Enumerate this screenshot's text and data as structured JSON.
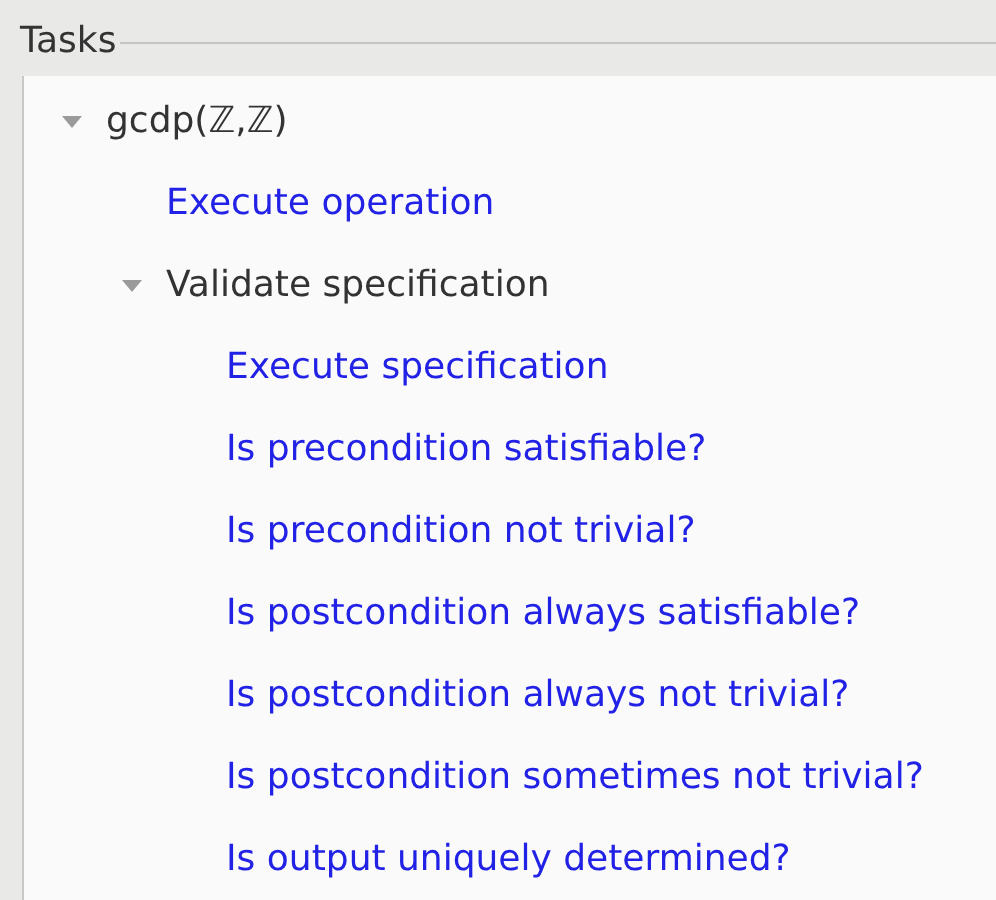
{
  "panel": {
    "title": "Tasks"
  },
  "tree": [
    {
      "kind": "group",
      "label": "gcdp(ℤ,ℤ)",
      "expanded": true,
      "children": [
        {
          "kind": "link",
          "label": "Execute operation"
        },
        {
          "kind": "group",
          "label": "Validate specification",
          "expanded": true,
          "children": [
            {
              "kind": "link",
              "label": "Execute specification"
            },
            {
              "kind": "link",
              "label": "Is precondition satisfiable?"
            },
            {
              "kind": "link",
              "label": "Is precondition not trivial?"
            },
            {
              "kind": "link",
              "label": "Is postcondition always satisfiable?"
            },
            {
              "kind": "link",
              "label": "Is postcondition always not trivial?"
            },
            {
              "kind": "link",
              "label": "Is postcondition sometimes not trivial?"
            },
            {
              "kind": "link",
              "label": "Is output uniquely determined?"
            }
          ]
        }
      ]
    }
  ]
}
